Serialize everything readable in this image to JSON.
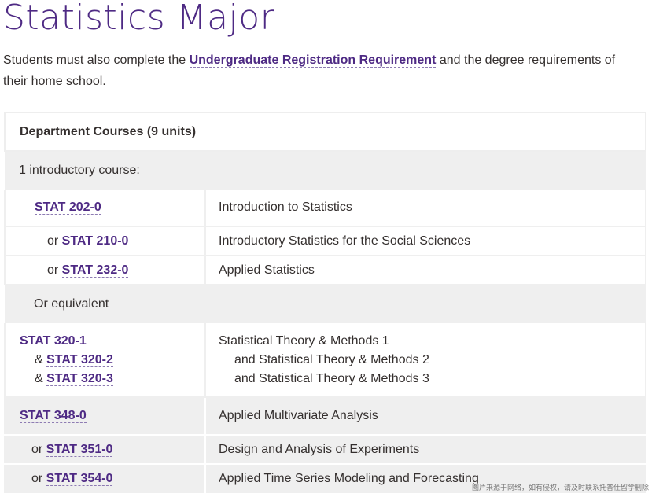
{
  "title": "Statistics Major",
  "intro": {
    "before": "Students must also complete the ",
    "link": "Undergraduate Registration Requirement",
    "after": " and the degree requirements of their home school."
  },
  "table": {
    "header": "Department Courses (9 units)",
    "group_intro": "1 introductory course:",
    "group_equiv": "Or equivalent",
    "rows": [
      {
        "prefix": "",
        "code": "STAT 202-0",
        "title": "Introduction to Statistics"
      },
      {
        "prefix": "or ",
        "code": "STAT 210-0",
        "title": "Introductory Statistics for the Social Sciences"
      },
      {
        "prefix": "or ",
        "code": "STAT 232-0",
        "title": "Applied Statistics"
      },
      {
        "prefix": "",
        "code": "STAT 320-1",
        "title": "Statistical Theory & Methods 1"
      },
      {
        "prefix": "& ",
        "code": "STAT 320-2",
        "title": "and Statistical Theory & Methods 2"
      },
      {
        "prefix": "& ",
        "code": "STAT 320-3",
        "title": "and Statistical Theory & Methods 3"
      },
      {
        "prefix": "",
        "code": "STAT 348-0",
        "title": "Applied Multivariate Analysis"
      },
      {
        "prefix": "or ",
        "code": "STAT 351-0",
        "title": "Design and Analysis of Experiments"
      },
      {
        "prefix": "or ",
        "code": "STAT 354-0",
        "title": "Applied Time Series Modeling and Forecasting"
      }
    ]
  },
  "watermark": "图片来源于网络，如有侵权，请及时联系托普仕留学删除"
}
